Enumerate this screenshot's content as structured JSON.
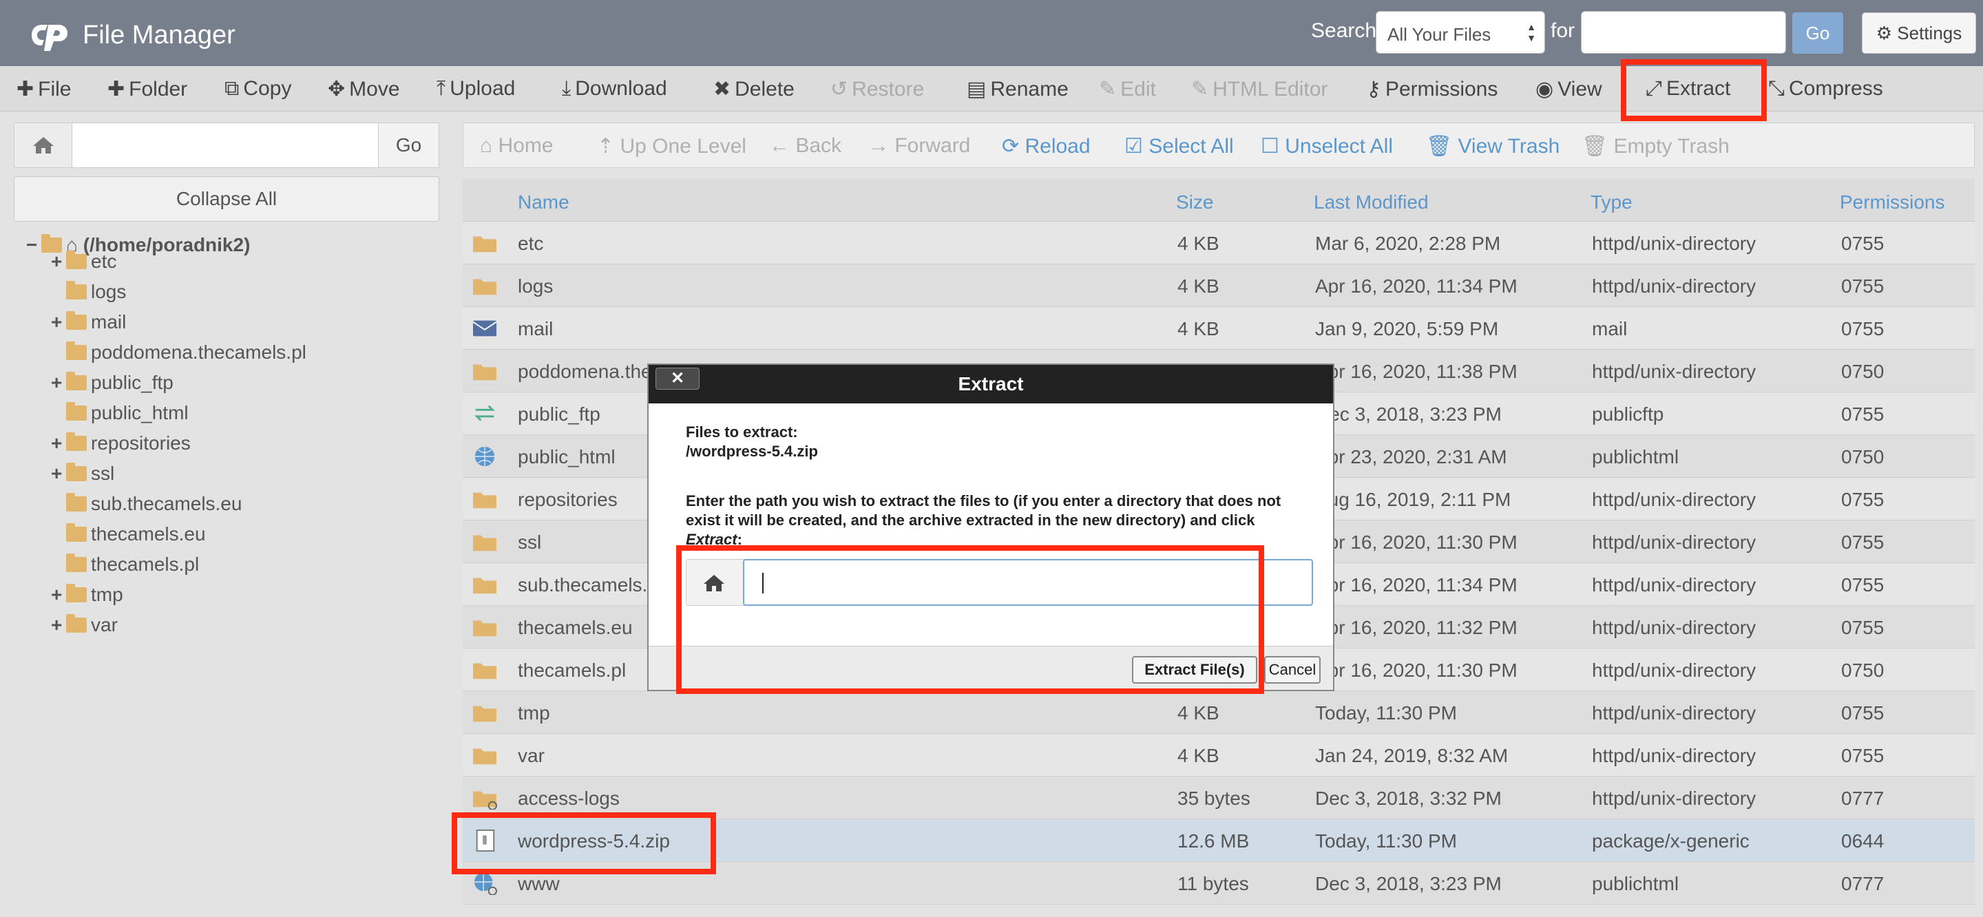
{
  "header": {
    "app_title": "File Manager",
    "search_label": "Search",
    "search_scope": "All Your Files",
    "for_label": "for",
    "search_placeholder": "",
    "go_label": "Go",
    "settings_label": "Settings"
  },
  "toolbar": {
    "file": "File",
    "folder": "Folder",
    "copy": "Copy",
    "move": "Move",
    "upload": "Upload",
    "download": "Download",
    "delete": "Delete",
    "restore": "Restore",
    "rename": "Rename",
    "edit": "Edit",
    "html_editor": "HTML Editor",
    "permissions": "Permissions",
    "view": "View",
    "extract": "Extract",
    "compress": "Compress"
  },
  "left": {
    "path_value": "",
    "go_label": "Go",
    "collapse_label": "Collapse All",
    "root": "(/home/poradnik2)",
    "tree": [
      {
        "label": "etc",
        "expandable": true
      },
      {
        "label": "logs",
        "expandable": false
      },
      {
        "label": "mail",
        "expandable": true
      },
      {
        "label": "poddomena.thecamels.pl",
        "expandable": false
      },
      {
        "label": "public_ftp",
        "expandable": true
      },
      {
        "label": "public_html",
        "expandable": false
      },
      {
        "label": "repositories",
        "expandable": true
      },
      {
        "label": "ssl",
        "expandable": true
      },
      {
        "label": "sub.thecamels.eu",
        "expandable": false
      },
      {
        "label": "thecamels.eu",
        "expandable": false
      },
      {
        "label": "thecamels.pl",
        "expandable": false
      },
      {
        "label": "tmp",
        "expandable": true
      },
      {
        "label": "var",
        "expandable": true
      }
    ]
  },
  "nav": {
    "home": "Home",
    "up": "Up One Level",
    "back": "Back",
    "forward": "Forward",
    "reload": "Reload",
    "select_all": "Select All",
    "unselect_all": "Unselect All",
    "view_trash": "View Trash",
    "empty_trash": "Empty Trash"
  },
  "table": {
    "headers": {
      "name": "Name",
      "size": "Size",
      "modified": "Last Modified",
      "type": "Type",
      "permissions": "Permissions"
    },
    "rows": [
      {
        "icon": "folder",
        "name": "etc",
        "size": "4 KB",
        "modified": "Mar 6, 2020, 2:28 PM",
        "type": "httpd/unix-directory",
        "perm": "0755"
      },
      {
        "icon": "folder",
        "name": "logs",
        "size": "4 KB",
        "modified": "Apr 16, 2020, 11:34 PM",
        "type": "httpd/unix-directory",
        "perm": "0755"
      },
      {
        "icon": "mail",
        "name": "mail",
        "size": "4 KB",
        "modified": "Jan 9, 2020, 5:59 PM",
        "type": "mail",
        "perm": "0755"
      },
      {
        "icon": "folder",
        "name": "poddomena.thecamels.pl",
        "size": "",
        "modified": "Apr 16, 2020, 11:38 PM",
        "type": "httpd/unix-directory",
        "perm": "0750"
      },
      {
        "icon": "ftp",
        "name": "public_ftp",
        "size": "",
        "modified": "Dec 3, 2018, 3:23 PM",
        "type": "publicftp",
        "perm": "0755"
      },
      {
        "icon": "globe",
        "name": "public_html",
        "size": "",
        "modified": "Apr 23, 2020, 2:31 AM",
        "type": "publichtml",
        "perm": "0750"
      },
      {
        "icon": "folder",
        "name": "repositories",
        "size": "",
        "modified": "Aug 16, 2019, 2:11 PM",
        "type": "httpd/unix-directory",
        "perm": "0755"
      },
      {
        "icon": "folder",
        "name": "ssl",
        "size": "",
        "modified": "Apr 16, 2020, 11:30 PM",
        "type": "httpd/unix-directory",
        "perm": "0755"
      },
      {
        "icon": "folder",
        "name": "sub.thecamels.eu",
        "size": "",
        "modified": "Apr 16, 2020, 11:34 PM",
        "type": "httpd/unix-directory",
        "perm": "0755"
      },
      {
        "icon": "folder",
        "name": "thecamels.eu",
        "size": "",
        "modified": "Apr 16, 2020, 11:32 PM",
        "type": "httpd/unix-directory",
        "perm": "0755"
      },
      {
        "icon": "folder",
        "name": "thecamels.pl",
        "size": "",
        "modified": "Apr 16, 2020, 11:30 PM",
        "type": "httpd/unix-directory",
        "perm": "0750"
      },
      {
        "icon": "folder",
        "name": "tmp",
        "size": "4 KB",
        "modified": "Today, 11:30 PM",
        "type": "httpd/unix-directory",
        "perm": "0755"
      },
      {
        "icon": "folder",
        "name": "var",
        "size": "4 KB",
        "modified": "Jan 24, 2019, 8:32 AM",
        "type": "httpd/unix-directory",
        "perm": "0755"
      },
      {
        "icon": "folder-link",
        "name": "access-logs",
        "size": "35 bytes",
        "modified": "Dec 3, 2018, 3:32 PM",
        "type": "httpd/unix-directory",
        "perm": "0777"
      },
      {
        "icon": "zip",
        "name": "wordpress-5.4.zip",
        "size": "12.6 MB",
        "modified": "Today, 11:30 PM",
        "type": "package/x-generic",
        "perm": "0644"
      },
      {
        "icon": "globe-link",
        "name": "www",
        "size": "11 bytes",
        "modified": "Dec 3, 2018, 3:23 PM",
        "type": "publichtml",
        "perm": "0777"
      }
    ]
  },
  "modal": {
    "title": "Extract",
    "close": "✕",
    "files_label": "Files to extract:",
    "file": "/wordpress-5.4.zip",
    "instructions": "Enter the path you wish to extract the files to (if you enter a directory that does not exist it will be created, and the archive extracted in the new directory) and click",
    "instructions_em": "Extract",
    "instructions_end": ":",
    "path_value": "",
    "extract_button": "Extract File(s)",
    "cancel_button": "Cancel"
  },
  "colors": {
    "accent": "#5b97cc",
    "highlight": "#ff2a12",
    "header": "#767f8b",
    "folder": "#e2b56d"
  }
}
